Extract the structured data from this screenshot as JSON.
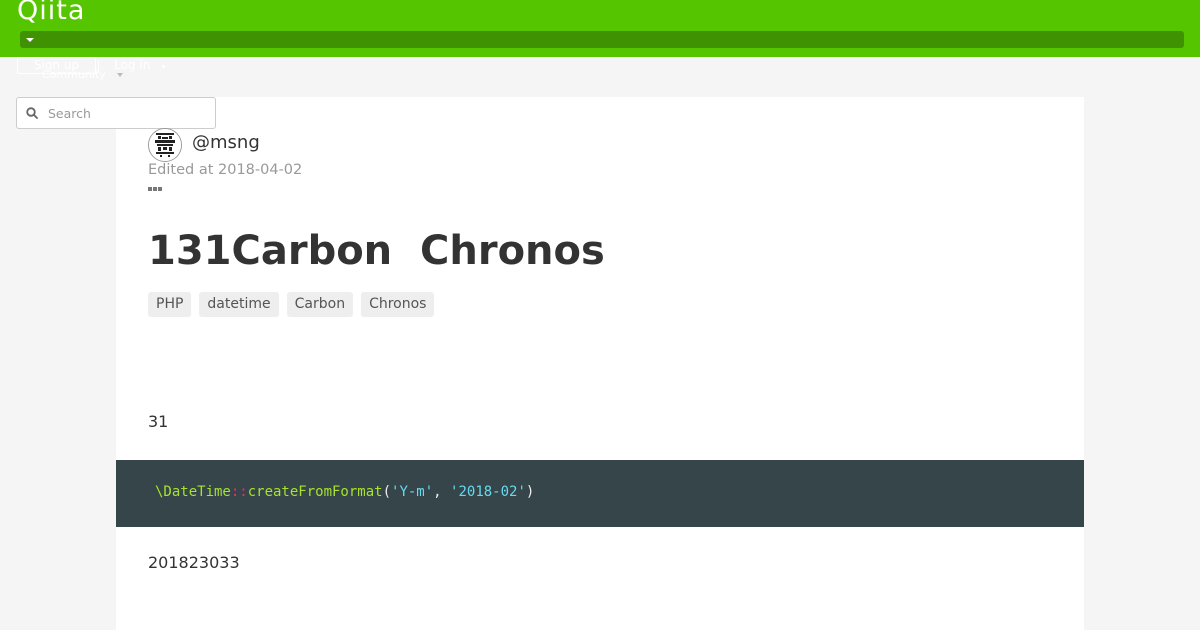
{
  "header": {
    "logo": "Qiita",
    "signup_label": "Sign up",
    "login_label": "Log in",
    "community_label": "Community",
    "brand_color": "#55c500"
  },
  "search": {
    "placeholder": "Search"
  },
  "article": {
    "author": "@msng",
    "edited": "Edited at 2018-04-02",
    "title": "131Carbon  Chronos",
    "tags": [
      "PHP",
      "datetime",
      "Carbon",
      "Chronos"
    ],
    "paragraph1": "31",
    "code": {
      "class": "\\DateTime",
      "op": "::",
      "method": "createFromFormat",
      "open": "(",
      "arg1": "'Y-m'",
      "comma": ", ",
      "arg2": "'2018-02'",
      "close": ")"
    },
    "paragraph2": "201823033"
  }
}
